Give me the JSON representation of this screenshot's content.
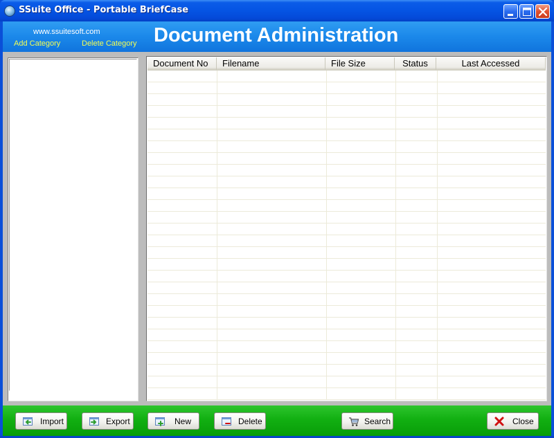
{
  "window": {
    "title": "SSuite Office - Portable BriefCase",
    "icons": {
      "app": "globe-icon",
      "minimize": "minimize-icon",
      "maximize": "maximize-icon",
      "close": "close-x-icon"
    }
  },
  "header": {
    "website": "www.ssuitesoft.com",
    "add_category": "Add Category",
    "delete_category": "Delete Category",
    "title": "Document Administration",
    "colors": {
      "link": "#f4ff52",
      "band": "#1b88ea"
    }
  },
  "grid": {
    "columns": [
      "Document No",
      "Filename",
      "File Size",
      "Status",
      "Last Accessed"
    ],
    "rows": []
  },
  "toolbar": {
    "import": "Import",
    "export": "Export",
    "new": "New",
    "delete": "Delete",
    "search": "Search",
    "close": "Close",
    "icons": {
      "import": "import-arrow-icon",
      "export": "export-arrow-icon",
      "new": "new-document-icon",
      "delete": "delete-document-icon",
      "search": "shopping-cart-icon",
      "close": "red-x-icon"
    },
    "colors": {
      "band": "#12b012",
      "close_x": "#d01010"
    }
  }
}
